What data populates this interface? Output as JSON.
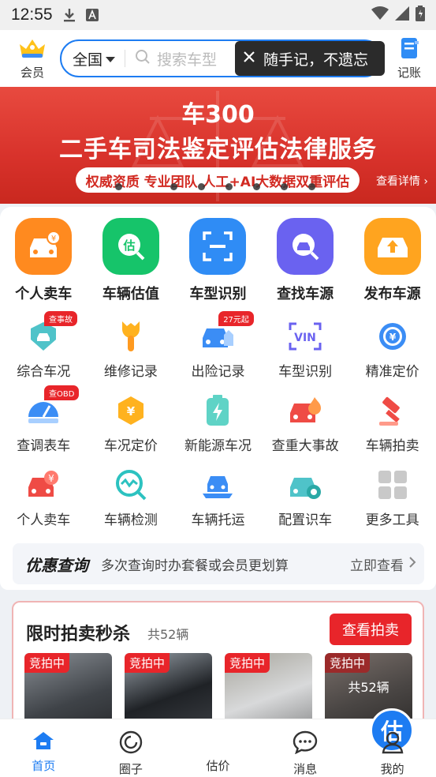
{
  "status_bar": {
    "time": "12:55"
  },
  "header": {
    "member_label": "会员",
    "city": "全国",
    "search_placeholder": "搜索车型",
    "ledger_label": "记账",
    "tooltip_text": "随手记，不遗忘"
  },
  "banner": {
    "title1": "车300",
    "title2": "二手车司法鉴定评估法律服务",
    "tagline": "权威资质 专业团队 人工+AI大数据双重评估",
    "detail_link": "查看详情"
  },
  "big_tools": [
    {
      "label": "个人卖车",
      "color": "#ff8a1f"
    },
    {
      "label": "车辆估值",
      "color": "#16c46a"
    },
    {
      "label": "车型识别",
      "color": "#2f8cf5"
    },
    {
      "label": "查找车源",
      "color": "#6a62f0"
    },
    {
      "label": "发布车源",
      "color": "#ffa41f"
    }
  ],
  "small_tools_row1": [
    {
      "label": "综合车况",
      "tag": "查事故"
    },
    {
      "label": "维修记录",
      "tag": ""
    },
    {
      "label": "出险记录",
      "tag": "27元起"
    },
    {
      "label": "车型识别",
      "tag": ""
    },
    {
      "label": "精准定价",
      "tag": ""
    }
  ],
  "small_tools_row2": [
    {
      "label": "查调表车",
      "tag": "查OBD"
    },
    {
      "label": "车况定价",
      "tag": ""
    },
    {
      "label": "新能源车况",
      "tag": ""
    },
    {
      "label": "查重大事故",
      "tag": ""
    },
    {
      "label": "车辆拍卖",
      "tag": ""
    }
  ],
  "small_tools_row3": [
    {
      "label": "个人卖车",
      "tag": ""
    },
    {
      "label": "车辆检测",
      "tag": ""
    },
    {
      "label": "车辆托运",
      "tag": ""
    },
    {
      "label": "配置识车",
      "tag": ""
    },
    {
      "label": "更多工具",
      "tag": ""
    }
  ],
  "promo": {
    "title": "优惠查询",
    "desc": "多次查询时办套餐或会员更划算",
    "link": "立即查看"
  },
  "auction": {
    "title": "限时拍卖秒杀",
    "count": "共52辆",
    "button": "查看拍卖",
    "badge": "竞拍中",
    "more_text": "共52辆"
  },
  "bottom_nav": {
    "home": "首页",
    "circle": "圈子",
    "estimate": "估价",
    "estimate_icon_text": "估",
    "messages": "消息",
    "mine": "我的"
  },
  "colors": {
    "accent": "#1d7cf2",
    "red": "#e8252a"
  }
}
